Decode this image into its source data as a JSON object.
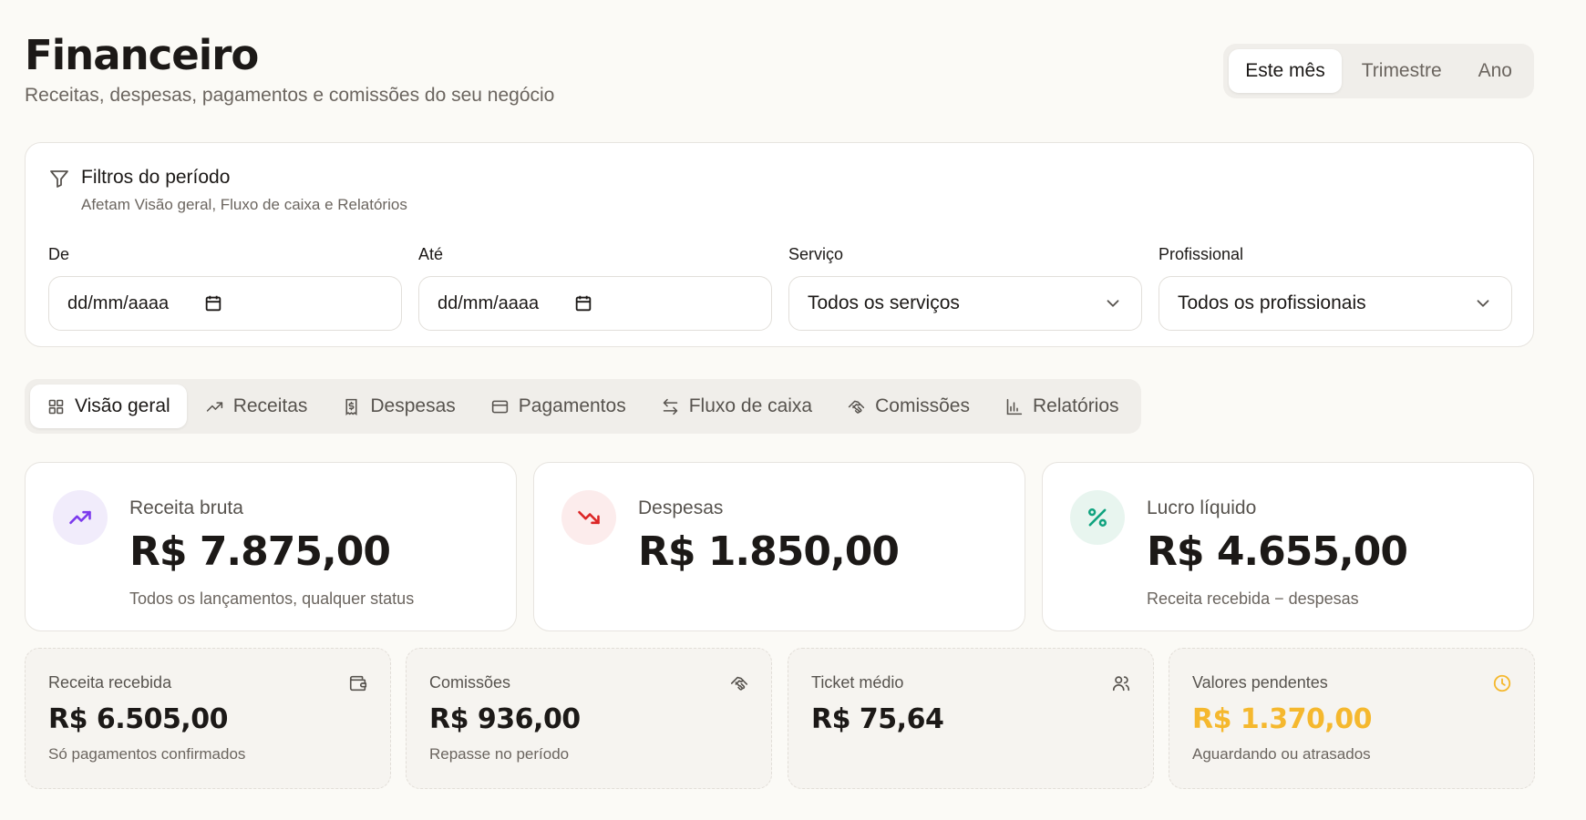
{
  "header": {
    "title": "Financeiro",
    "subtitle": "Receitas, despesas, pagamentos e comissões do seu negócio",
    "periods": [
      "Este mês",
      "Trimestre",
      "Ano"
    ],
    "active_period": "Este mês"
  },
  "filters": {
    "title": "Filtros do período",
    "description": "Afetam Visão geral, Fluxo de caixa e Relatórios",
    "icon": "filter-icon",
    "fields": [
      {
        "label": "De",
        "value": "dd/mm/aaaa",
        "type": "date",
        "icon": "calendar-icon"
      },
      {
        "label": "Até",
        "value": "dd/mm/aaaa",
        "type": "date",
        "icon": "calendar-icon"
      },
      {
        "label": "Serviço",
        "value": "Todos os serviços",
        "type": "select",
        "icon": "chevron-down-icon"
      },
      {
        "label": "Profissional",
        "value": "Todos os profissionais",
        "type": "select",
        "icon": "chevron-down-icon"
      }
    ]
  },
  "tabs": [
    {
      "label": "Visão geral",
      "icon": "grid-icon",
      "active": true
    },
    {
      "label": "Receitas",
      "icon": "trending-up-icon"
    },
    {
      "label": "Despesas",
      "icon": "receipt-icon"
    },
    {
      "label": "Pagamentos",
      "icon": "credit-card-icon"
    },
    {
      "label": "Fluxo de caixa",
      "icon": "arrows-exchange-icon"
    },
    {
      "label": "Comissões",
      "icon": "handshake-icon"
    },
    {
      "label": "Relatórios",
      "icon": "bar-chart-icon"
    }
  ],
  "summary_cards": [
    {
      "label": "Receita bruta",
      "value": "R$ 7.875,00",
      "note": "Todos os lançamentos, qualquer status",
      "icon": "trending-up-icon",
      "icon_color": "#7c3aed",
      "icon_bg": "#f1ecfb"
    },
    {
      "label": "Despesas",
      "value": "R$ 1.850,00",
      "note": "",
      "icon": "trending-down-icon",
      "icon_color": "#dc2626",
      "icon_bg": "#fcecec"
    },
    {
      "label": "Lucro líquido",
      "value": "R$ 4.655,00",
      "note": "Receita recebida − despesas",
      "icon": "percent-icon",
      "icon_color": "#10a37f",
      "icon_bg": "#e8f5ef"
    }
  ],
  "metric_cards": [
    {
      "label": "Receita recebida",
      "value": "R$ 6.505,00",
      "note": "Só pagamentos confirmados",
      "icon": "wallet-icon"
    },
    {
      "label": "Comissões",
      "value": "R$ 936,00",
      "note": "Repasse no período",
      "icon": "handshake-icon"
    },
    {
      "label": "Ticket médio",
      "value": "R$ 75,64",
      "note": "",
      "icon": "users-icon"
    },
    {
      "label": "Valores pendentes",
      "value": "R$ 1.370,00",
      "note": "Aguardando ou atrasados",
      "icon": "clock-icon",
      "highlight_color": "#f5b82e"
    }
  ]
}
